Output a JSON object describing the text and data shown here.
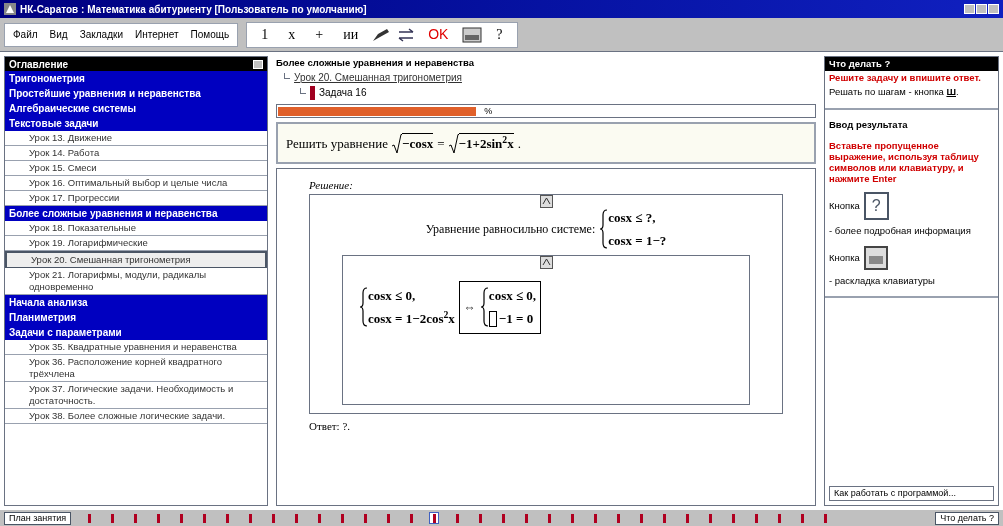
{
  "window": {
    "title": "НК-Саратов : Математика абитуриенту [Пользователь по умолчанию]"
  },
  "menu": [
    "Файл",
    "Вид",
    "Закладки",
    "Интернет",
    "Помощь"
  ],
  "toolbar": [
    {
      "kind": "text",
      "label": "1"
    },
    {
      "kind": "text",
      "label": "x"
    },
    {
      "kind": "text",
      "label": "+"
    },
    {
      "kind": "text",
      "label": "ии"
    },
    {
      "kind": "pen"
    },
    {
      "kind": "swap"
    },
    {
      "kind": "ok",
      "label": "OK"
    },
    {
      "kind": "keyboard"
    },
    {
      "kind": "text",
      "label": "?"
    }
  ],
  "sidebar": {
    "title": "Оглавление",
    "sections": [
      {
        "label": "Тригонометрия"
      },
      {
        "label": "Простейшие уравнения и неравенства"
      },
      {
        "label": "Алгебраические системы"
      },
      {
        "label": "Текстовые задачи",
        "children": [
          {
            "label": "Урок 13. Движение",
            "selected": false
          },
          {
            "label": "Урок 14. Работа",
            "selected": false
          },
          {
            "label": "Урок 15. Смеси",
            "selected": false
          },
          {
            "label": "Урок 16. Оптимальный выбор и целые числа",
            "selected": false
          },
          {
            "label": "Урок 17. Прогрессии",
            "selected": false
          }
        ]
      },
      {
        "label": "Более сложные уравнения и неравенства",
        "children": [
          {
            "label": "Урок 18. Показательные",
            "selected": false
          },
          {
            "label": "Урок 19. Логарифмические",
            "selected": false
          },
          {
            "label": "Урок 20. Смешанная тригонометрия",
            "selected": true
          },
          {
            "label": "Урок 21. Логарифмы, модули, радикалы одновременно",
            "selected": false
          }
        ]
      },
      {
        "label": "Начала анализа"
      },
      {
        "label": "Планиметрия"
      },
      {
        "label": "Задачи с параметрами",
        "children": [
          {
            "label": "Урок 35. Квадратные уравнения и неравенства",
            "selected": false
          },
          {
            "label": "Урок 36. Расположение корней квадратного трёхчлена",
            "selected": false
          },
          {
            "label": "Урок 37. Логические задачи. Необходимость и достаточность.",
            "selected": false
          },
          {
            "label": "Урок 38. Более сложные логические задачи.",
            "selected": false
          }
        ]
      }
    ]
  },
  "breadcrumb": {
    "topic": "Более сложные уравнения и неравенства",
    "lesson": "Урок 20. Смешанная тригонометрия",
    "task": "Задача 16"
  },
  "progress": {
    "level": 0.37,
    "label": "%"
  },
  "problem": {
    "prompt": "Решить уравнение",
    "left": "−cosx",
    "eq": "=",
    "right": "−1+2sin$^{2}$x",
    "end": "."
  },
  "solution": {
    "title": "Решение:",
    "intro": "Уравнение равносильно системе:",
    "system": [
      "cosx ≤ ?,",
      "cosx = 1−?"
    ],
    "step": {
      "system": [
        "cosx ≤ 0,",
        "cosx = 1−2cos$^{2}$x"
      ],
      "arrow": "⇔",
      "result": [
        "cosx ≤ 0,",
        "−1 = 0"
      ]
    },
    "answer": "Ответ: ?."
  },
  "help": {
    "title": "Что делать ?",
    "task": "Решите задачу и впишите ответ.",
    "steps": "Решать по шагам - кнопка",
    "steps_key": "Ш",
    "steps_end": ".",
    "input_title": "Ввод результата",
    "input_text": "Вставьте пропущенное выражение, используя таблицу символов или клавиатуру, и нажмите Enter",
    "help_prefix": "Кнопка",
    "help_key": "?",
    "help_text": "- более подробная информация",
    "kbd_prefix": "Кнопка",
    "kbd_text": "- раскладка клавиатуры",
    "how": "Как работать с программой..."
  },
  "bottom": {
    "plan": "План занятия",
    "what": "Что делать ?",
    "steps": [
      {
        "selected": false
      },
      {
        "selected": false
      },
      {
        "selected": false
      },
      {
        "selected": false
      },
      {
        "selected": false
      },
      {
        "selected": false
      },
      {
        "selected": false
      },
      {
        "selected": false
      },
      {
        "selected": false
      },
      {
        "selected": false
      },
      {
        "selected": false
      },
      {
        "selected": false
      },
      {
        "selected": false
      },
      {
        "selected": false
      },
      {
        "selected": false
      },
      {
        "selected": true
      },
      {
        "selected": false
      },
      {
        "selected": false
      },
      {
        "selected": false
      },
      {
        "selected": false
      },
      {
        "selected": false
      },
      {
        "selected": false
      },
      {
        "selected": false
      },
      {
        "selected": false
      },
      {
        "selected": false
      },
      {
        "selected": false
      },
      {
        "selected": false
      },
      {
        "selected": false
      },
      {
        "selected": false
      },
      {
        "selected": false
      },
      {
        "selected": false
      },
      {
        "selected": false
      },
      {
        "selected": false
      }
    ]
  }
}
